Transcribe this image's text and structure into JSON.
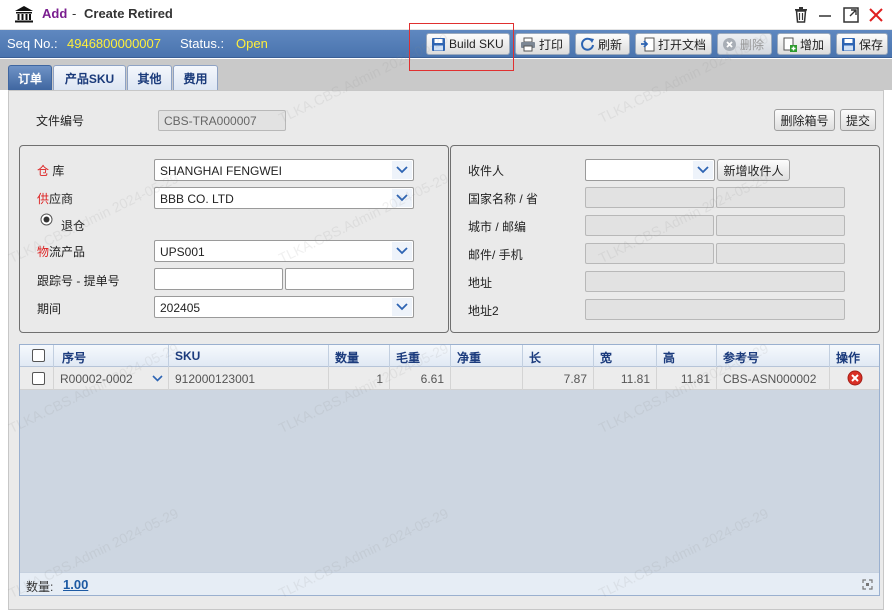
{
  "window": {
    "title_add": "Add",
    "title_sep": "-",
    "title_rest": "Create Retired"
  },
  "toolbar": {
    "seq_label": "Seq No.:",
    "seq_value": "4946800000007",
    "status_label": "Status.:",
    "status_value": "Open",
    "buttons": {
      "build_sku": "Build SKU",
      "print": "打印",
      "refresh": "刷新",
      "open_doc": "打开文档",
      "delete": "删除",
      "add": "增加",
      "save": "保存"
    }
  },
  "tabs": [
    "订单",
    "产品SKU",
    "其他",
    "费用"
  ],
  "form": {
    "doc_no_label": "文件编号",
    "doc_no_value": "CBS-TRA000007",
    "delete_box_button": "删除箱号",
    "submit_button": "提交",
    "left": {
      "warehouse_first": "仓",
      "warehouse_rest": " 库",
      "warehouse_value": "SHANGHAI FENGWEI",
      "supplier_first": "供",
      "supplier_rest": "应商",
      "supplier_value": "BBB CO. LTD",
      "return_label": "退仓",
      "logistics_first": "物",
      "logistics_rest": "流产品",
      "logistics_value": "UPS001",
      "tracking_label": "跟踪号 - 提单号",
      "tracking_value": "",
      "bol_value": "",
      "period_label": "期间",
      "period_value": "202405"
    },
    "right": {
      "recipient_label": "收件人",
      "recipient_value": "",
      "add_recipient_button": "新增收件人",
      "country_label": "国家名称 / 省",
      "city_label": "城市 / 邮编",
      "email_label": "邮件/ 手机",
      "address_label": "地址",
      "address2_label": "地址2"
    }
  },
  "grid": {
    "columns": [
      "序号",
      "SKU",
      "数量",
      "毛重",
      "净重",
      "长",
      "宽",
      "高",
      "参考号",
      "操作"
    ],
    "rows": [
      {
        "seq": "R00002-0002",
        "sku": "912000123001",
        "qty": "1",
        "gross": "6.61",
        "net": "",
        "length": "7.87",
        "width": "11.81",
        "height": "11.81",
        "ref": "CBS-ASN000002"
      }
    ],
    "footer_label": "数量:",
    "footer_value": "1.00"
  },
  "watermark": "TLKA.CBS.Admin 2024-05-29",
  "colors": {
    "toolbar_bg": "#4a74ae",
    "highlight_value": "#ffef3a",
    "title_add": "#7a1e8f",
    "required_char": "#dd2222",
    "highlight_box": "#e03030"
  }
}
